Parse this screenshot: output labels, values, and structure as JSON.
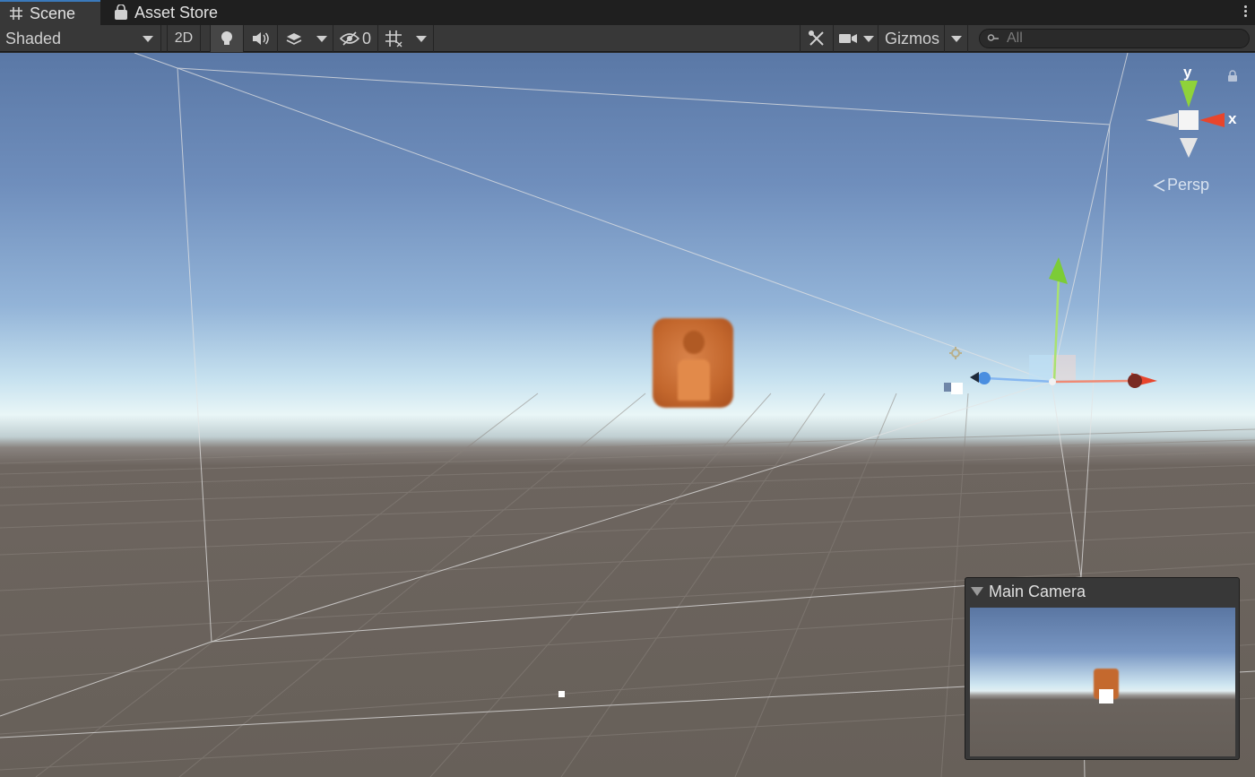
{
  "tabs": [
    {
      "label": "Scene",
      "icon": "grid-hash-icon",
      "active": true
    },
    {
      "label": "Asset Store",
      "icon": "shopping-bag-icon",
      "active": false
    }
  ],
  "toolbar": {
    "draw_mode": "Shaded",
    "mode_2d": "2D",
    "hidden_count": "0",
    "gizmos_label": "Gizmos",
    "search_placeholder": "All"
  },
  "orientation_gizmo": {
    "y_label": "y",
    "x_label": "x",
    "projection_label": "Persp",
    "colors": {
      "y": "#8fd33a",
      "x": "#e8452c",
      "neutral": "#d8d8d8"
    }
  },
  "camera_preview": {
    "title": "Main Camera"
  },
  "colors": {
    "accent": "#3a79bb",
    "toolbar_bg": "#383838",
    "tabbar_bg": "#1f1f1f",
    "player_orange": "#c3672d",
    "handle_x": "#e8452c",
    "handle_y": "#8fd33a",
    "handle_z": "#4a8ee0"
  }
}
